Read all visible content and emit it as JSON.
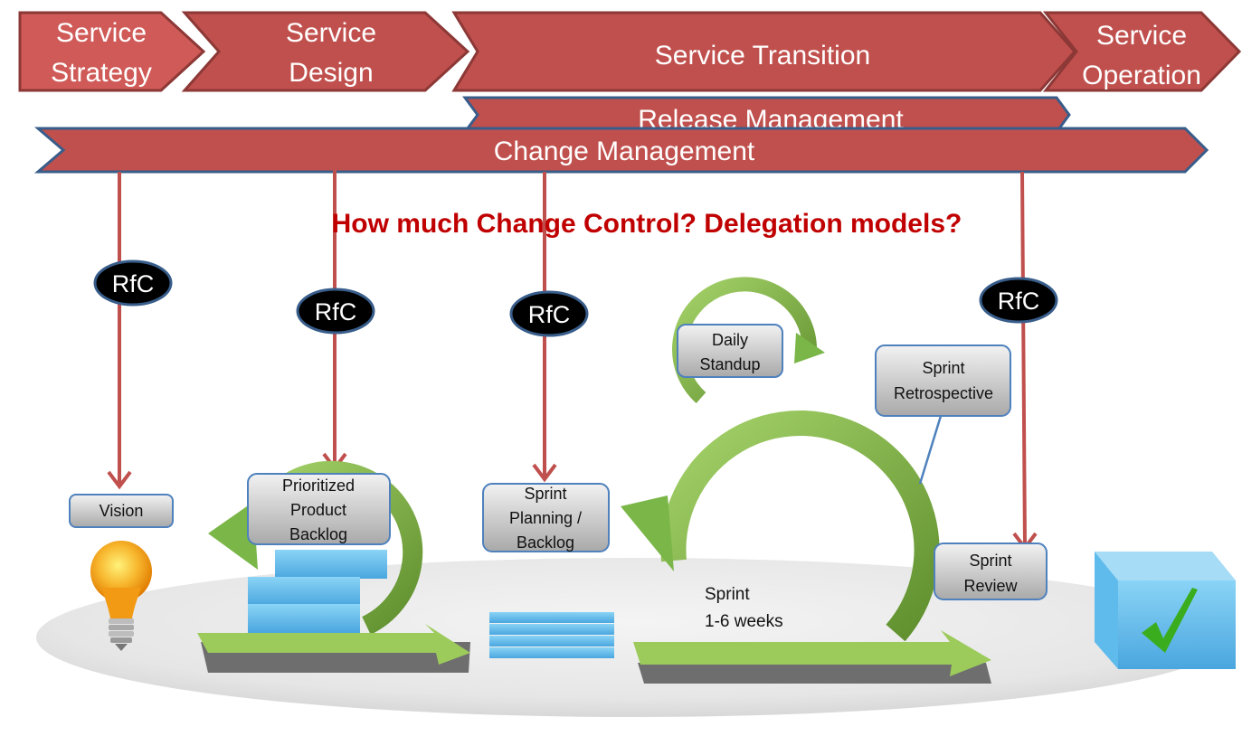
{
  "phases": [
    {
      "lines": [
        "Service",
        "Strategy"
      ]
    },
    {
      "lines": [
        "Service",
        "Design"
      ]
    },
    {
      "lines": [
        "Service Transition"
      ]
    },
    {
      "lines": [
        "Service",
        "Operation"
      ]
    }
  ],
  "bands": {
    "release": "Release Management",
    "change": "Change Management"
  },
  "question": "How much Change Control? Delegation models?",
  "rfc_label": "RfC",
  "boxes": {
    "vision": [
      "Vision"
    ],
    "product_backlog": [
      "Prioritized",
      "Product",
      "Backlog"
    ],
    "sprint_planning": [
      "Sprint",
      "Planning /",
      "Backlog"
    ],
    "daily_standup": [
      "Daily",
      "Standup"
    ],
    "retrospective": [
      "Sprint",
      "Retrospective"
    ],
    "review": [
      "Sprint",
      "Review"
    ]
  },
  "sprint_label": [
    "Sprint",
    "1-6 weeks"
  ],
  "colors": {
    "phase_fill": "#c0504d",
    "phase_border": "#8c3836",
    "band_border": "#385d8a",
    "question": "#c00000",
    "arrow_red": "#c0504d",
    "green": "#7ab648",
    "blue_block": "#6cc3ee",
    "check": "#3aad1f"
  }
}
